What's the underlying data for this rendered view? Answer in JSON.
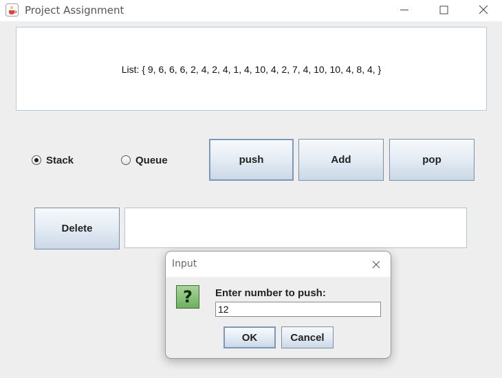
{
  "window": {
    "title": "Project Assignment",
    "icons": {
      "app": "java-cup-icon",
      "minimize": "minimize-icon",
      "maximize": "maximize-icon",
      "close": "close-icon"
    }
  },
  "main": {
    "list_text": "List: { 9, 6, 6, 6, 2, 4, 2, 4, 1, 4, 10, 4, 2, 7, 4, 10, 10, 4, 8, 4, }",
    "radios": {
      "stack": {
        "label": "Stack",
        "selected": true
      },
      "queue": {
        "label": "Queue",
        "selected": false
      }
    },
    "buttons": {
      "push": "push",
      "add": "Add",
      "pop": "pop",
      "delete": "Delete"
    },
    "text_field_value": ""
  },
  "dialog": {
    "title": "Input",
    "prompt": "Enter number to push:",
    "input_value": "12",
    "ok_label": "OK",
    "cancel_label": "Cancel",
    "icon": "question-icon"
  },
  "colors": {
    "button_border": "#7a8ea4",
    "question_icon_green": "#6fb05f"
  }
}
